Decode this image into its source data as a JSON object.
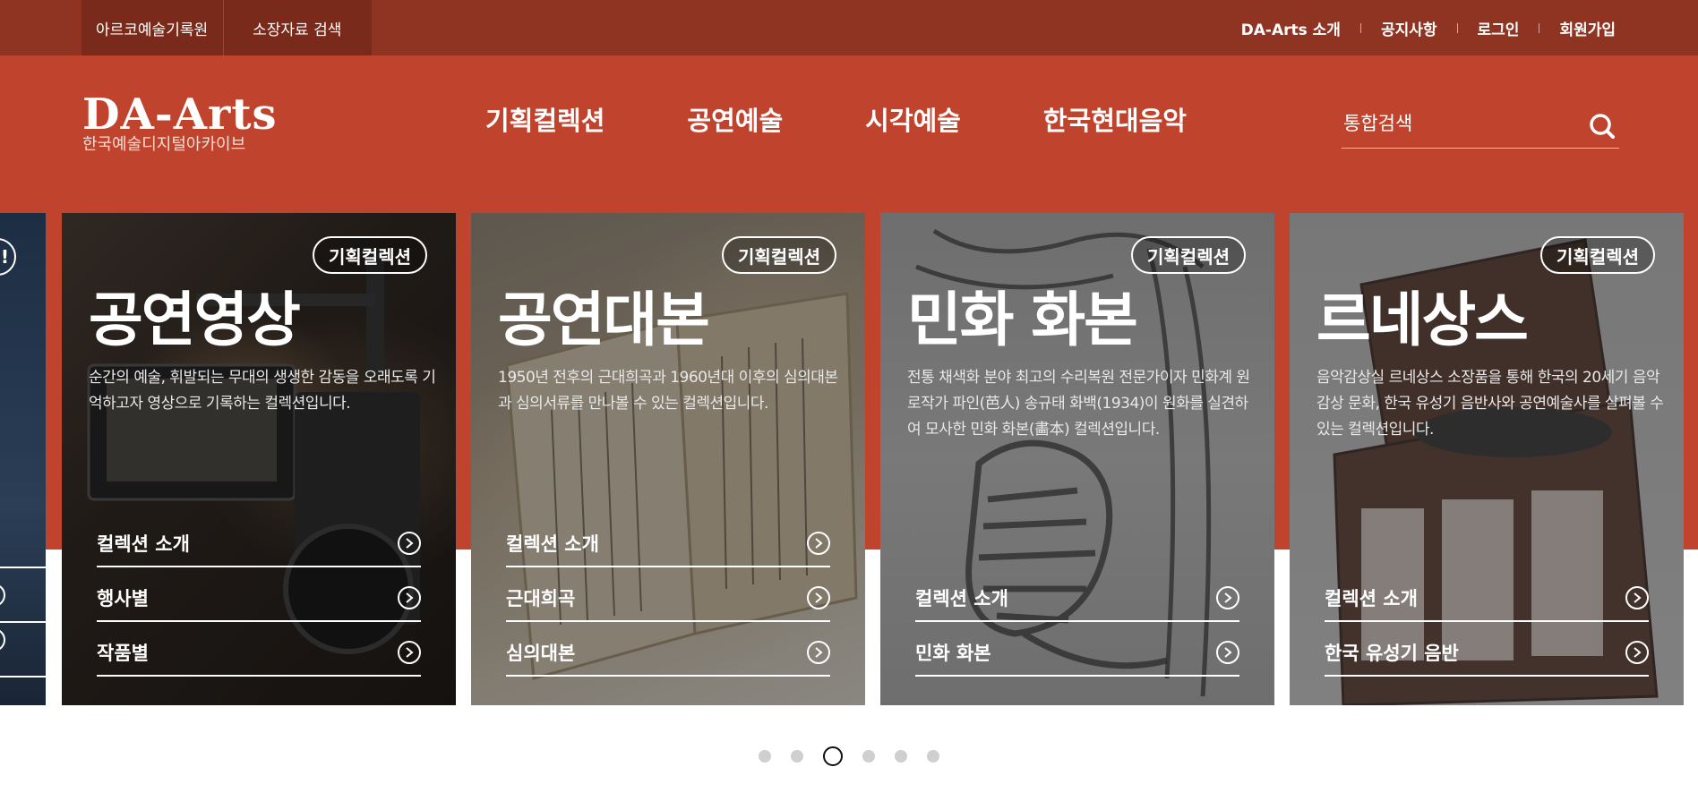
{
  "topbar": {
    "tabs": [
      "아르코예술기록원",
      "소장자료 검색"
    ],
    "links": [
      "DA-Arts 소개",
      "공지사항",
      "로그인",
      "회원가입"
    ]
  },
  "header": {
    "logo_main": "DA-Arts",
    "logo_sub": "한국예술디지털아카이브",
    "nav": [
      "기획컬렉션",
      "공연예술",
      "시각예술",
      "한국현대음악"
    ],
    "search_placeholder": "통합검색"
  },
  "slider": {
    "prev_badge": "!",
    "cards": [
      {
        "badge": "기획컬렉션",
        "title": "공연영상",
        "desc": "순간의 예술, 휘발되는 무대의 생생한 감동을 오래도록 기억하고자 영상으로 기록하는 컬렉션입니다.",
        "links": [
          "컬렉션 소개",
          "행사별",
          "작품별"
        ]
      },
      {
        "badge": "기획컬렉션",
        "title": "공연대본",
        "desc": "1950년 전후의 근대희곡과 1960년대 이후의 심의대본과 심의서류를 만나볼 수 있는 컬렉션입니다.",
        "links": [
          "컬렉션 소개",
          "근대희곡",
          "심의대본"
        ]
      },
      {
        "badge": "기획컬렉션",
        "title": "민화 화본",
        "desc": "전통 채색화 분야 최고의 수리복원 전문가이자 민화계 원로작가 파인(芭人) 송규태 화백(1934)이 원화를 실견하여 모사한 민화 화본(畵本) 컬렉션입니다.",
        "links": [
          "컬렉션 소개",
          "민화 화본"
        ]
      },
      {
        "badge": "기획컬렉션",
        "title": "르네상스",
        "desc": "음악감상실 르네상스 소장품을 통해 한국의 20세기 음악 감상 문화, 한국 유성기 음반사와 공연예술사를 살펴볼 수 있는 컬렉션입니다.",
        "links": [
          "컬렉션 소개",
          "한국 유성기 음반"
        ]
      }
    ]
  },
  "pagination": {
    "count": 6,
    "active": 3
  },
  "colors": {
    "topbar": "#8f3422",
    "header": "#c0432d"
  }
}
